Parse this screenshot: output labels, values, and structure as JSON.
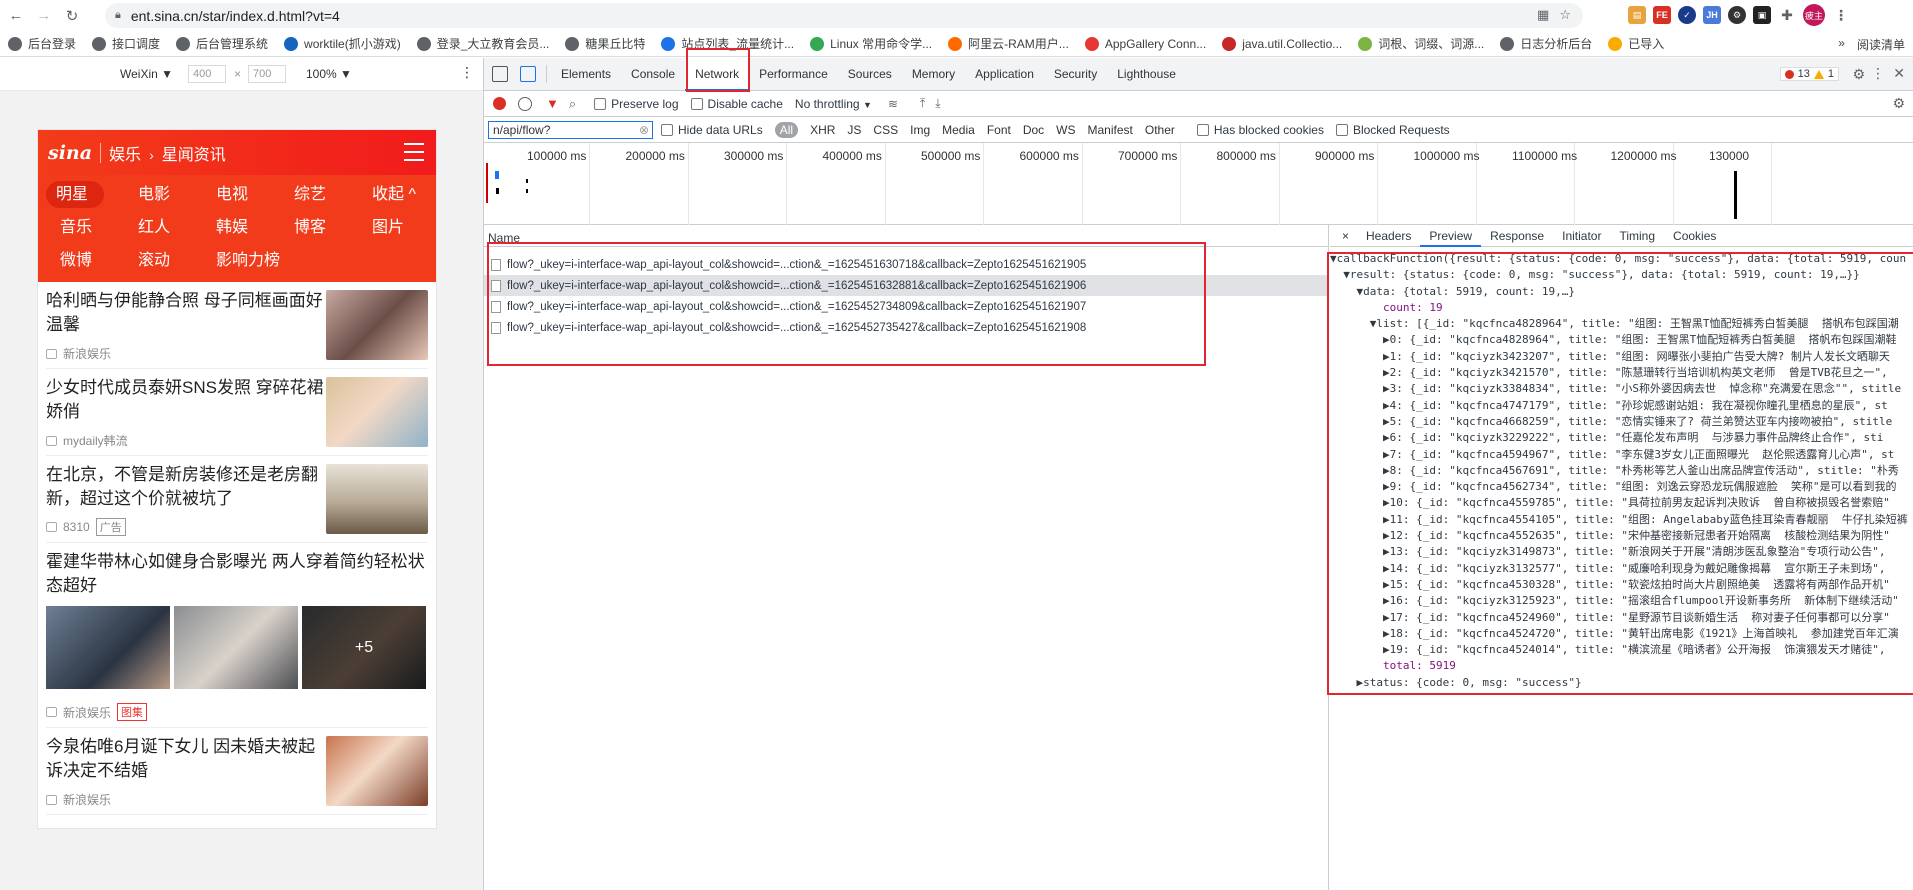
{
  "browser": {
    "url": "ent.sina.cn/star/index.d.html?vt=4",
    "bookmarks": [
      "后台登录",
      "接口调度",
      "后台管理系统",
      "worktile(抓小游戏)",
      "登录_大立教育会员...",
      "糖果丘比特",
      "站点列表_流量统计...",
      "Linux 常用命令学...",
      "阿里云-RAM用户...",
      "AppGallery Conn...",
      "java.util.Collectio...",
      "词根、词缀、词源...",
      "日志分析后台",
      "已导入"
    ],
    "bookmarks_more": "»",
    "reading_list": "阅读清单",
    "avatar_text": "疲主"
  },
  "device_toolbar": {
    "device": "WeiXin ▼",
    "width": "400",
    "height": "700",
    "zoom": "100% ▼"
  },
  "sina": {
    "logo": "sina",
    "section": "娱乐",
    "subsection": "星闻资讯",
    "channels": [
      "明星",
      "电影",
      "电视",
      "综艺",
      "收起 ^",
      "音乐",
      "红人",
      "韩娱",
      "博客",
      "图片",
      "微博",
      "滚动",
      "影响力榜"
    ],
    "news": [
      {
        "title": "哈利晒与伊能静合照 母子同框画面好温馨",
        "source": "新浪娱乐",
        "tag": ""
      },
      {
        "title": "少女时代成员泰妍SNS发照 穿碎花裙娇俏",
        "source": "mydaily韩流",
        "tag": ""
      },
      {
        "title": "在北京，不管是新房装修还是老房翻新，超过这个价就被坑了",
        "source": "8310",
        "tag": "广告"
      },
      {
        "title": "霍建华带林心如健身合影曝光 两人穿着简约轻松状态超好",
        "source": "新浪娱乐",
        "tag": "图集",
        "more": "+5"
      },
      {
        "title": "今泉佑唯6月诞下女儿 因未婚夫被起诉决定不结婚",
        "source": "新浪娱乐",
        "tag": ""
      }
    ]
  },
  "devtools": {
    "tabs": [
      "Elements",
      "Console",
      "Network",
      "Performance",
      "Sources",
      "Memory",
      "Application",
      "Security",
      "Lighthouse"
    ],
    "active_tab": "Network",
    "errors": "13",
    "warnings": "1",
    "preserve_log": "Preserve log",
    "disable_cache": "Disable cache",
    "throttling": "No throttling",
    "filter_value": "n/api/flow?",
    "hide_data_urls": "Hide data URLs",
    "filter_types": [
      "All",
      "XHR",
      "JS",
      "CSS",
      "Img",
      "Media",
      "Font",
      "Doc",
      "WS",
      "Manifest",
      "Other"
    ],
    "has_blocked": "Has blocked cookies",
    "blocked_requests": "Blocked Requests",
    "timeline_ticks": [
      "100000 ms",
      "200000 ms",
      "300000 ms",
      "400000 ms",
      "500000 ms",
      "600000 ms",
      "700000 ms",
      "800000 ms",
      "900000 ms",
      "1000000 ms",
      "1100000 ms",
      "1200000 ms",
      "130000"
    ],
    "name_header": "Name",
    "requests": [
      "flow?_ukey=i-interface-wap_api-layout_col&showcid=...ction&_=1625451630718&callback=Zepto1625451621905",
      "flow?_ukey=i-interface-wap_api-layout_col&showcid=...ction&_=1625451632881&callback=Zepto1625451621906",
      "flow?_ukey=i-interface-wap_api-layout_col&showcid=...ction&_=1625452734809&callback=Zepto1625451621907",
      "flow?_ukey=i-interface-wap_api-layout_col&showcid=...ction&_=1625452735427&callback=Zepto1625451621908"
    ],
    "preview_tabs": [
      "×",
      "Headers",
      "Preview",
      "Response",
      "Initiator",
      "Timing",
      "Cookies"
    ],
    "active_preview_tab": "Preview",
    "json_lines": [
      "▼callbackFunction({result: {status: {code: 0, msg: \"success\"}, data: {total: 5919, coun",
      "  ▼result: {status: {code: 0, msg: \"success\"}, data: {total: 5919, count: 19,…}}",
      "    ▼data: {total: 5919, count: 19,…}",
      "        count: 19",
      "      ▼list: [{_id: \"kqcfnca4828964\", title: \"组图: 王智黑T恤配短裤秀白皙美腿  搭帆布包踩国潮",
      "        ▶0: {_id: \"kqcfnca4828964\", title: \"组图: 王智黑T恤配短裤秀白皙美腿  搭帆布包踩国潮鞋",
      "        ▶1: {_id: \"kqciyzk3423207\", title: \"组图: 网曝张小斐拍广告受大牌? 制片人发长文晒聊天",
      "        ▶2: {_id: \"kqciyzk3421570\", title: \"陈慧珊转行当培训机构英文老师  曾是TVB花旦之一\",",
      "        ▶3: {_id: \"kqciyzk3384834\", title: \"小S称外婆因病去世  悼念称\"充满爱在思念\"\", stitle",
      "        ▶4: {_id: \"kqcfnca4747179\", title: \"孙珍妮感谢站姐: 我在凝视你瞳孔里栖息的星辰\", st",
      "        ▶5: {_id: \"kqcfnca4668259\", title: \"恋情实锤来了? 荷兰弟赞达亚车内接吻被拍\", stitle",
      "        ▶6: {_id: \"kqciyzk3229222\", title: \"任嘉伦发布声明  与涉暴力事件品牌终止合作\", sti",
      "        ▶7: {_id: \"kqcfnca4594967\", title: \"李东健3岁女儿正面照曝光  赵伦熙透露育儿心声\", st",
      "        ▶8: {_id: \"kqcfnca4567691\", title: \"朴秀彬等艺人釜山出席品牌宣传活动\", stitle: \"朴秀",
      "        ▶9: {_id: \"kqcfnca4562734\", title: \"组图: 刘逸云穿恐龙玩偶服遮脸  笑称\"是可以看到我的",
      "        ▶10: {_id: \"kqcfnca4559785\", title: \"具荷拉前男友起诉判决败诉  曾自称被损毁名誉索赔\"",
      "        ▶11: {_id: \"kqcfnca4554105\", title: \"组图: Angelababy蓝色挂耳染青春靓丽  牛仔扎染短裤",
      "        ▶12: {_id: \"kqcfnca4552635\", title: \"宋仲基密接新冠患者开始隔离  核酸检测结果为阴性\"",
      "        ▶13: {_id: \"kqciyzk3149873\", title: \"新浪网关于开展\"清朗涉医乱象整治\"专项行动公告\",",
      "        ▶14: {_id: \"kqciyzk3132577\", title: \"威廉哈利现身为戴妃雕像揭幕  宣尔斯王子未到场\",",
      "        ▶15: {_id: \"kqcfnca4530328\", title: \"软瓷炫拍时尚大片剧照绝美  透露将有两部作品开机\"",
      "        ▶16: {_id: \"kqciyzk3125923\", title: \"摇滚组合flumpool开设新事务所  新体制下继续活动\"",
      "        ▶17: {_id: \"kqcfnca4524960\", title: \"星野源节目谈新婚生活  称对妻子任何事都可以分享\"",
      "        ▶18: {_id: \"kqcfnca4524720\", title: \"黄轩出席电影《1921》上海首映礼  参加建党百年汇演",
      "        ▶19: {_id: \"kqcfnca4524014\", title: \"横滨流星《暗诱者》公开海报  饰演猥发天才赌徒\",",
      "        total: 5919",
      "    ▶status: {code: 0, msg: \"success\"}"
    ]
  }
}
